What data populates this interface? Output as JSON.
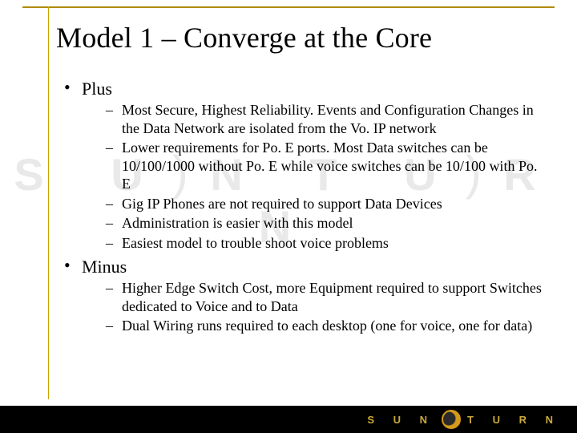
{
  "title": "Model 1 – Converge at the Core",
  "watermark_letters": [
    "S",
    "U",
    "N",
    "T",
    "U",
    "R",
    "N"
  ],
  "sections": [
    {
      "label": "Plus",
      "items": [
        "Most Secure, Highest Reliability.  Events and Configuration Changes in the Data Network are isolated from the Vo. IP network",
        "Lower requirements for Po. E ports. Most Data switches can be 10/100/1000 without Po. E while voice switches can be 10/100 with Po. E",
        " Gig IP Phones are not required to support Data Devices",
        "Administration is easier with this model",
        "Easiest model to trouble shoot voice problems"
      ]
    },
    {
      "label": "Minus",
      "items": [
        "Higher Edge Switch Cost, more Equipment required to support Switches dedicated to Voice and to Data",
        " Dual Wiring runs required to each desktop (one for voice, one for data)"
      ]
    }
  ],
  "footer": {
    "brand_left": "S U N",
    "brand_right": "T U R N"
  }
}
